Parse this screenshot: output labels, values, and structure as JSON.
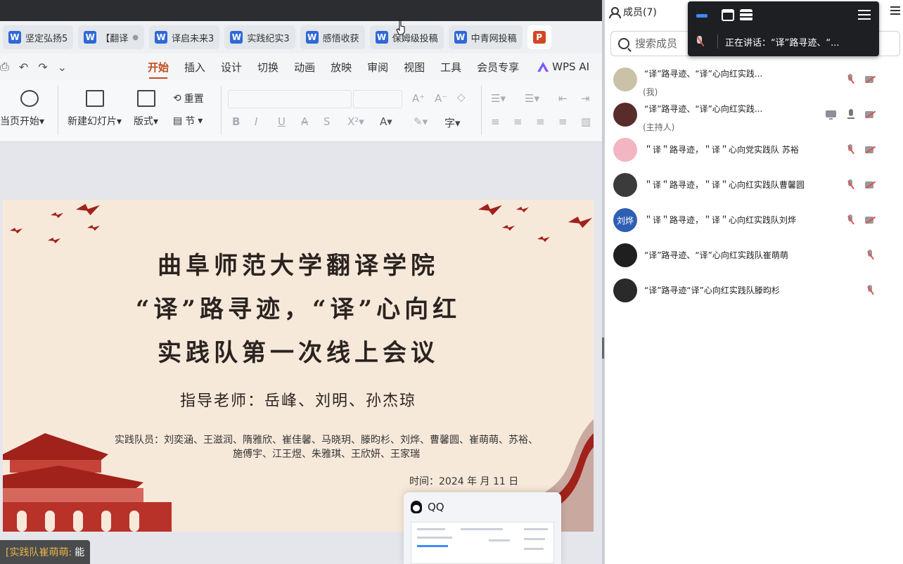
{
  "tabs": [
    {
      "icon": "W",
      "label": "坚定弘扬5"
    },
    {
      "icon": "W",
      "label": "【翻译"
    },
    {
      "icon": "W",
      "label": "译启未来3"
    },
    {
      "icon": "W",
      "label": "实践纪实3"
    },
    {
      "icon": "W",
      "label": "感悟收获"
    },
    {
      "icon": "W",
      "label": "保姆级投稿"
    },
    {
      "icon": "W",
      "label": "中青网投稿"
    },
    {
      "icon": "P",
      "label": ""
    }
  ],
  "menu": [
    "开始",
    "插入",
    "设计",
    "切换",
    "动画",
    "放映",
    "审阅",
    "视图",
    "工具",
    "会员专享"
  ],
  "menu_active": "开始",
  "wps_ai": "WPS AI",
  "ribbon": {
    "from_current": "当页开始",
    "new_slide": "新建幻灯片",
    "layout": "版式",
    "reset": "重置",
    "section": "节"
  },
  "slide": {
    "title1": "曲阜师范大学翻译学院",
    "title2": "“译”路寻迹，“译”心向红",
    "title3": "实践队第一次线上会议",
    "teachers": "指导老师：岳峰、刘明、孙杰琼",
    "members_line1": "实践队员：刘奕涵、王滋润、隋雅欣、崔佳馨、马晓玥、滕昀杉、刘烨、曹馨圆、崔萌萌、苏裕、",
    "members_line2": "施傅宇、江王煜、朱雅琪、王欣妍、王家瑞",
    "time": "时间：2024 年 月 11 日"
  },
  "overlay_chat": {
    "sender": "[实践队崔萌萌:",
    "text": "能"
  },
  "qq_popup": {
    "title": "QQ"
  },
  "panel": {
    "title": "成员(7)",
    "search_placeholder": "搜索成员",
    "members": [
      {
        "name": "“译”路寻迹、“译”心向红实践...",
        "role": "(我)",
        "avatar_color": "#c9c1a8",
        "avatar_text": "",
        "icons": [
          "mic-off",
          "cam-off"
        ]
      },
      {
        "name": "“译”路寻迹、“译”心向红实践...",
        "role": "(主持人)",
        "avatar_color": "#5a2b2b",
        "avatar_text": "",
        "icons": [
          "screen",
          "mic-on",
          "cam-off"
        ]
      },
      {
        "name": "＂译＂路寻迹，＂译＂心向党实践队 苏裕",
        "role": "",
        "avatar_color": "#f1b6c1",
        "avatar_text": "",
        "icons": [
          "mic-off",
          "cam-off"
        ]
      },
      {
        "name": "＂译＂路寻迹，＂译＂心向红实践队曹馨圆",
        "role": "",
        "avatar_color": "#3b3b3b",
        "avatar_text": "",
        "icons": [
          "mic-off",
          "cam-off"
        ]
      },
      {
        "name": "＂译＂路寻迹，＂译＂心向红实践队刘烨",
        "role": "",
        "avatar_color": "#2f5fb3",
        "avatar_text": "刘烨",
        "icons": [
          "mic-off",
          "cam-off"
        ]
      },
      {
        "name": "“译”路寻迹、“译”心向红实践队崔萌萌",
        "role": "",
        "avatar_color": "#1f1f1f",
        "avatar_text": "",
        "icons": [
          "mic-off"
        ]
      },
      {
        "name": "“译”路寻迹“译”心向红实践队滕昀杉",
        "role": "",
        "avatar_color": "#2a2a2a",
        "avatar_text": "",
        "icons": [
          "mic-off"
        ]
      }
    ]
  },
  "float_bar": {
    "speaking": "正在讲话：“译”路寻迹、“..."
  },
  "colors": {
    "accent": "#c24c1c",
    "word_blue": "#2f68d8",
    "ppt_red": "#d24726",
    "mute_red": "#e05252"
  }
}
